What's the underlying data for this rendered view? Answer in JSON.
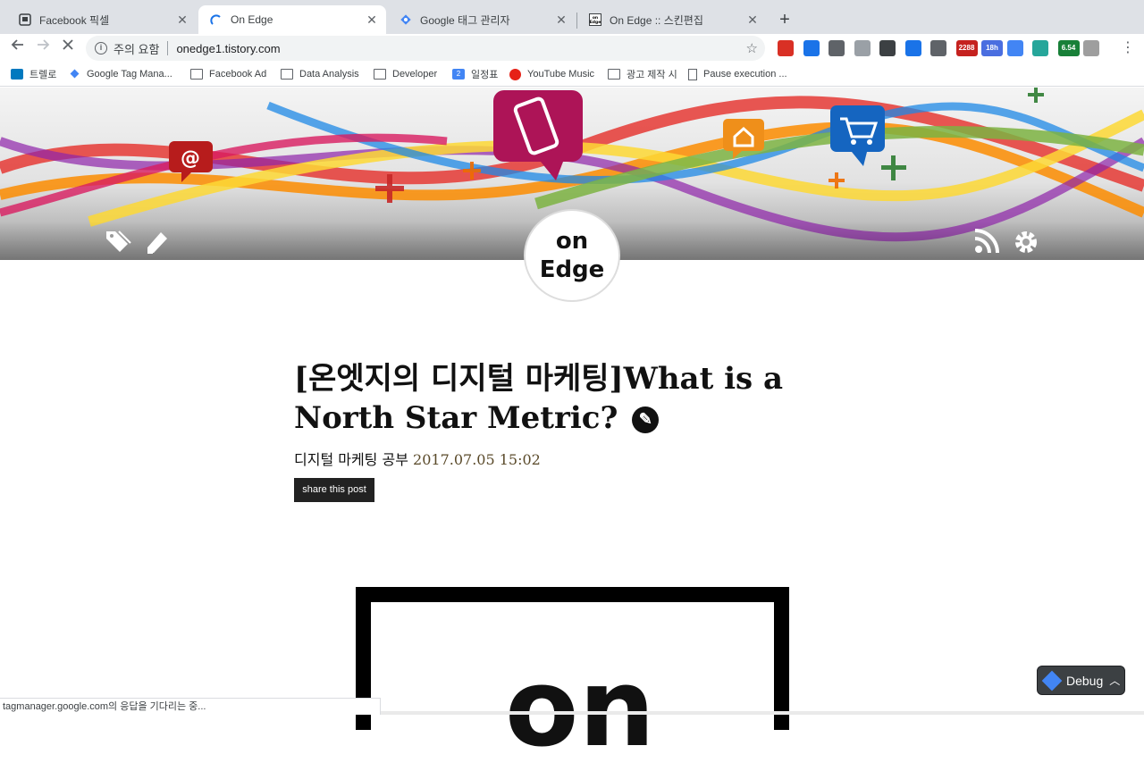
{
  "tabs": [
    {
      "title": "Facebook 픽셀",
      "favicon": "facebook-pixel-icon",
      "active": false
    },
    {
      "title": "On Edge",
      "favicon": "loading-spinner-icon",
      "active": true
    },
    {
      "title": "Google 태그 관리자",
      "favicon": "google-tag-manager-icon",
      "active": false
    },
    {
      "title": "On Edge :: 스킨편집",
      "favicon": "on-edge-icon",
      "active": false
    }
  ],
  "omnibox": {
    "security_label": "주의 요함",
    "url": "onedge1.tistory.com"
  },
  "extensions": [
    {
      "icon": "ext-red-gear-icon",
      "color": "#d93025",
      "badge": ""
    },
    {
      "icon": "ext-blue-icon",
      "color": "#1a73e8",
      "badge": ""
    },
    {
      "icon": "ext-tool-icon",
      "color": "#5f6368",
      "badge": ""
    },
    {
      "icon": "ext-code-icon",
      "color": "#9aa0a6",
      "badge": ""
    },
    {
      "icon": "ext-save-icon",
      "color": "#3c4043",
      "badge": ""
    },
    {
      "icon": "ext-eye-icon",
      "color": "#1a73e8",
      "badge": ""
    },
    {
      "icon": "ext-gauge-icon",
      "color": "#5f6368",
      "badge": ""
    },
    {
      "icon": "ext-gmail-icon",
      "color": "#c5221f",
      "badge": "2288"
    },
    {
      "icon": "ext-calendar-icon",
      "color": "#4a6ee0",
      "badge": "18h"
    },
    {
      "icon": "ext-translate-icon",
      "color": "#4285f4",
      "badge": ""
    },
    {
      "icon": "ext-circle-icon",
      "color": "#26a69a",
      "badge": ""
    },
    {
      "icon": "ext-speed-icon",
      "color": "#188038",
      "badge": "6.54"
    },
    {
      "icon": "ext-avatar-icon",
      "color": "#9e9e9e",
      "badge": ""
    }
  ],
  "bookmarks": [
    {
      "label": "트렐로",
      "icon": "trello-icon"
    },
    {
      "label": "Google Tag Mana...",
      "icon": "gtm-icon"
    },
    {
      "label": "Facebook Ad",
      "icon": "folder-icon"
    },
    {
      "label": "Data Analysis",
      "icon": "folder-icon"
    },
    {
      "label": "Developer",
      "icon": "folder-icon"
    },
    {
      "label": "일정표",
      "icon": "calendar-icon"
    },
    {
      "label": "YouTube Music",
      "icon": "youtube-music-icon"
    },
    {
      "label": "광고 제작 시",
      "icon": "folder-icon"
    },
    {
      "label": "Pause execution ...",
      "icon": "page-icon"
    }
  ],
  "calendar_bookmark_day": "2",
  "logo": {
    "line1": "on",
    "line2": "Edge"
  },
  "post": {
    "title": "[온엣지의 디지털 마케팅]What is a North Star Metric?",
    "category": "디지털 마케팅 공부",
    "date": "2017.07.05 15:02",
    "share_label": "share this post",
    "image_text": "on"
  },
  "debug": {
    "label": "Debug"
  },
  "status": "tagmanager.google.com의 응답을 기다리는 중..."
}
